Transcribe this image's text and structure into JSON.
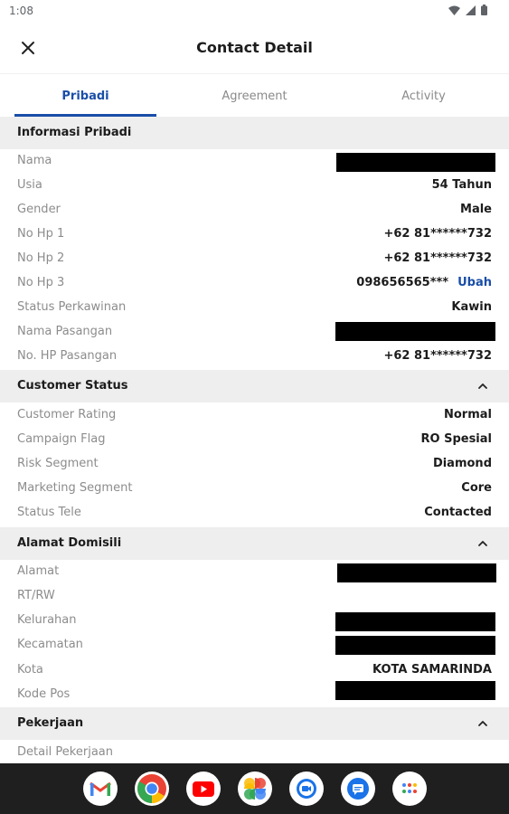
{
  "status_bar": {
    "time": "1:08"
  },
  "header": {
    "title": "Contact Detail"
  },
  "tabs": [
    {
      "label": "Pribadi",
      "active": true
    },
    {
      "label": "Agreement",
      "active": false
    },
    {
      "label": "Activity",
      "active": false
    }
  ],
  "sections": {
    "informasi_pribadi": {
      "title": "Informasi Pribadi",
      "rows": [
        {
          "label": "Nama",
          "value": "",
          "redacted": true
        },
        {
          "label": "Usia",
          "value": "54 Tahun"
        },
        {
          "label": "Gender",
          "value": "Male"
        },
        {
          "label": "No Hp 1",
          "value": "+62 81******732"
        },
        {
          "label": "No Hp 2",
          "value": "+62 81******732"
        },
        {
          "label": "No Hp 3",
          "value": "098656565***",
          "action": "Ubah"
        },
        {
          "label": "Status Perkawinan",
          "value": "Kawin"
        },
        {
          "label": "Nama Pasangan",
          "value": "",
          "redacted": true
        },
        {
          "label": "No. HP Pasangan",
          "value": "+62 81******732"
        }
      ]
    },
    "customer_status": {
      "title": "Customer Status",
      "rows": [
        {
          "label": "Customer Rating",
          "value": "Normal"
        },
        {
          "label": "Campaign Flag",
          "value": "RO Spesial"
        },
        {
          "label": "Risk Segment",
          "value": "Diamond"
        },
        {
          "label": "Marketing Segment",
          "value": "Core"
        },
        {
          "label": "Status Tele",
          "value": "Contacted"
        }
      ]
    },
    "alamat_domisili": {
      "title": "Alamat Domisili",
      "rows": [
        {
          "label": "Alamat",
          "value": "",
          "redacted": true
        },
        {
          "label": "RT/RW",
          "value": ""
        },
        {
          "label": "Kelurahan",
          "value": "",
          "redacted": true
        },
        {
          "label": "Kecamatan",
          "value": "",
          "redacted": true
        },
        {
          "label": "Kota",
          "value": "KOTA SAMARINDA"
        },
        {
          "label": "Kode Pos",
          "value": "",
          "redacted": true
        }
      ]
    },
    "pekerjaan": {
      "title": "Pekerjaan",
      "rows": [
        {
          "label": "Detail Pekerjaan",
          "value": ""
        }
      ]
    }
  },
  "dock_apps": [
    "gmail-icon",
    "chrome-icon",
    "youtube-icon",
    "photos-icon",
    "duo-icon",
    "messages-icon",
    "app-drawer-icon"
  ],
  "colors": {
    "accent": "#1a4ea8",
    "section_bg": "#eeeeef",
    "label": "#8c8c8c",
    "navbar": "#1f1f1f"
  }
}
